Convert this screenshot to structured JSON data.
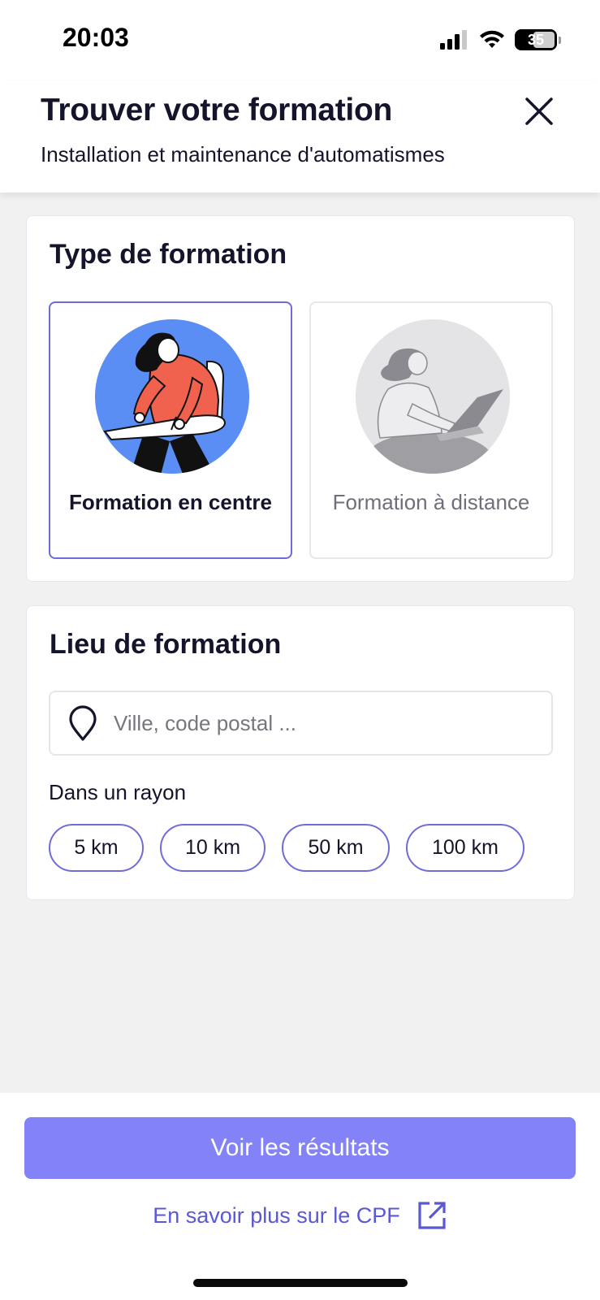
{
  "status_bar": {
    "time": "20:03",
    "battery": "35"
  },
  "header": {
    "title": "Trouver votre formation",
    "subtitle": "Installation et maintenance d'automatismes"
  },
  "type_section": {
    "title": "Type de formation",
    "options": [
      {
        "label": "Formation en centre",
        "selected": true
      },
      {
        "label": "Formation à distance",
        "selected": false
      }
    ]
  },
  "lieu_section": {
    "title": "Lieu de formation",
    "location_placeholder": "Ville, code postal ...",
    "location_value": "",
    "radius_label": "Dans un rayon",
    "radius_options": [
      "5 km",
      "10 km",
      "50 km",
      "100 km"
    ]
  },
  "footer": {
    "primary_button": "Voir les résultats",
    "cpf_link": "En savoir plus sur le CPF"
  },
  "colors": {
    "accent": "#6f6cd9",
    "primary_button_bg": "#8382f7",
    "link": "#5b58d6",
    "illustration_blue": "#5b8ef5",
    "illustration_red": "#f0624d"
  }
}
